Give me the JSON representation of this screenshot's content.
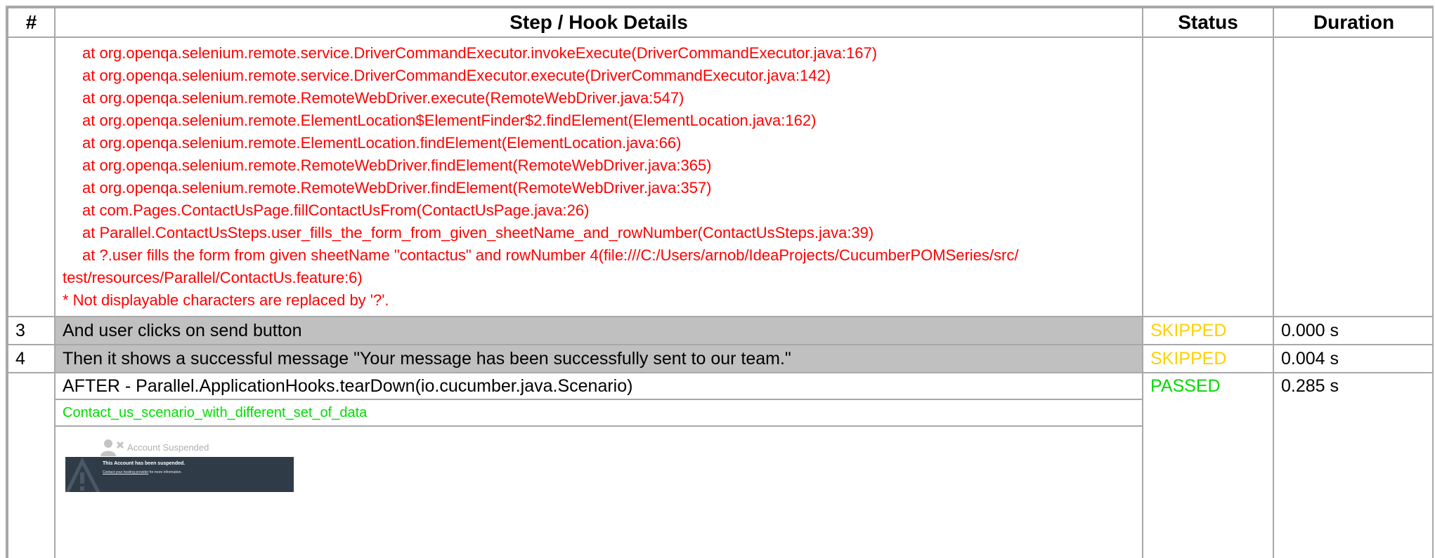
{
  "table": {
    "headers": {
      "num": "#",
      "details": "Step / Hook Details",
      "status": "Status",
      "duration": "Duration"
    }
  },
  "trace": {
    "lines": [
      "at org.openqa.selenium.remote.service.DriverCommandExecutor.invokeExecute(DriverCommandExecutor.java:167)",
      "at org.openqa.selenium.remote.service.DriverCommandExecutor.execute(DriverCommandExecutor.java:142)",
      "at org.openqa.selenium.remote.RemoteWebDriver.execute(RemoteWebDriver.java:547)",
      "at org.openqa.selenium.remote.ElementLocation$ElementFinder$2.findElement(ElementLocation.java:162)",
      "at org.openqa.selenium.remote.ElementLocation.findElement(ElementLocation.java:66)",
      "at org.openqa.selenium.remote.RemoteWebDriver.findElement(RemoteWebDriver.java:365)",
      "at org.openqa.selenium.remote.RemoteWebDriver.findElement(RemoteWebDriver.java:357)",
      "at com.Pages.ContactUsPage.fillContactUsFrom(ContactUsPage.java:26)",
      "at Parallel.ContactUsSteps.user_fills_the_form_from_given_sheetName_and_rowNumber(ContactUsSteps.java:39)",
      "at ?.user fills the form from given sheetName \"contactus\" and rowNumber 4(file:///C:/Users/arnob/IdeaProjects/CucumberPOMSeries/src/"
    ],
    "wrap_line": "test/resources/Parallel/ContactUs.feature:6)",
    "note": "* Not displayable characters are replaced by '?'."
  },
  "steps": [
    {
      "num": "3",
      "text": "And user clicks on send button",
      "status": "SKIPPED",
      "duration": "0.000 s"
    },
    {
      "num": "4",
      "text": "Then it shows a successful message \"Your message has been successfully sent to our team.\"",
      "status": "SKIPPED",
      "duration": "0.004 s"
    }
  ],
  "after_hook": {
    "title": "AFTER - Parallel.ApplicationHooks.tearDown(io.cucumber.java.Scenario)",
    "scenario_name": "Contact_us_scenario_with_different_set_of_data",
    "status": "PASSED",
    "duration": "0.285 s",
    "screenshot": {
      "caption": "Account Suspended",
      "heading": "This Account has been suspended.",
      "link_text": "Contact your hosting provider",
      "sub_text": " for more information.",
      "icon": "user-x-icon",
      "watermark": "warning-triangle-icon"
    }
  },
  "colors": {
    "error": "#ff0000",
    "skipped": "#ffd100",
    "passed": "#00dd00",
    "step_bg": "#c0c0c0",
    "border": "#a8a8a8",
    "banner_bg": "#2f3c48"
  }
}
